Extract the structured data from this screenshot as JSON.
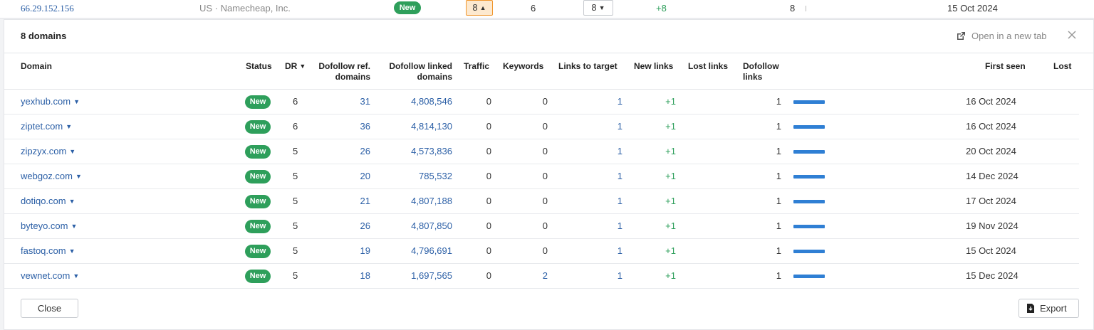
{
  "background_row": {
    "ip": "66.29.152.156",
    "location": "US · Namecheap, Inc.",
    "status": "New",
    "active_count": "8",
    "dofollow_count": "6",
    "dropdown_count": "8",
    "new_links": "+8",
    "links_count": "8",
    "first_seen": "15 Oct 2024"
  },
  "panel": {
    "title": "8 domains",
    "open_new_tab": "Open in a new tab"
  },
  "columns": {
    "domain": "Domain",
    "status": "Status",
    "dr": "DR",
    "dofollow_ref_domains": "Dofollow ref. domains",
    "dofollow_linked_domains": "Dofollow linked domains",
    "traffic": "Traffic",
    "keywords": "Keywords",
    "links_to_target": "Links to target",
    "new_links": "New links",
    "lost_links": "Lost links",
    "dofollow_links": "Dofollow links",
    "first_seen": "First seen",
    "lost": "Lost"
  },
  "rows": [
    {
      "domain": "yexhub.com",
      "status": "New",
      "dr": "6",
      "ref": "31",
      "linked": "4,808,546",
      "traffic": "0",
      "keywords": "0",
      "links_to_target": "1",
      "new_links": "+1",
      "dofollow": "1",
      "bar_level": 1,
      "first_seen": "16 Oct 2024"
    },
    {
      "domain": "ziptet.com",
      "status": "New",
      "dr": "6",
      "ref": "36",
      "linked": "4,814,130",
      "traffic": "0",
      "keywords": "0",
      "links_to_target": "1",
      "new_links": "+1",
      "dofollow": "1",
      "bar_level": 1,
      "first_seen": "16 Oct 2024"
    },
    {
      "domain": "zipzyx.com",
      "status": "New",
      "dr": "5",
      "ref": "26",
      "linked": "4,573,836",
      "traffic": "0",
      "keywords": "0",
      "links_to_target": "1",
      "new_links": "+1",
      "dofollow": "1",
      "bar_level": 1,
      "first_seen": "20 Oct 2024"
    },
    {
      "domain": "webgoz.com",
      "status": "New",
      "dr": "5",
      "ref": "20",
      "linked": "785,532",
      "traffic": "0",
      "keywords": "0",
      "links_to_target": "1",
      "new_links": "+1",
      "dofollow": "1",
      "bar_level": 1,
      "first_seen": "14 Dec 2024"
    },
    {
      "domain": "dotiqo.com",
      "status": "New",
      "dr": "5",
      "ref": "21",
      "linked": "4,807,188",
      "traffic": "0",
      "keywords": "0",
      "links_to_target": "1",
      "new_links": "+1",
      "dofollow": "1",
      "bar_level": 1,
      "first_seen": "17 Oct 2024"
    },
    {
      "domain": "byteyo.com",
      "status": "New",
      "dr": "5",
      "ref": "26",
      "linked": "4,807,850",
      "traffic": "0",
      "keywords": "0",
      "links_to_target": "1",
      "new_links": "+1",
      "dofollow": "1",
      "bar_level": 1,
      "first_seen": "19 Nov 2024"
    },
    {
      "domain": "fastoq.com",
      "status": "New",
      "dr": "5",
      "ref": "19",
      "linked": "4,796,691",
      "traffic": "0",
      "keywords": "0",
      "links_to_target": "1",
      "new_links": "+1",
      "dofollow": "1",
      "bar_level": 1,
      "first_seen": "15 Oct 2024"
    },
    {
      "domain": "vewnet.com",
      "status": "New",
      "dr": "5",
      "ref": "18",
      "linked": "1,697,565",
      "traffic": "0",
      "keywords": "2",
      "links_to_target": "1",
      "new_links": "+1",
      "dofollow": "1",
      "bar_level": 1,
      "first_seen": "15 Dec 2024"
    }
  ],
  "footer": {
    "close_label": "Close",
    "export_label": "Export"
  },
  "icons": {
    "open_new_tab": "external-link-icon",
    "close": "close-icon",
    "export": "export-icon",
    "sort": "sort-down-icon",
    "caret": "caret-down-icon"
  },
  "colors": {
    "link": "#2b5fa6",
    "new_badge": "#2e9f5b",
    "bar": "#2f7fd4",
    "active_outline": "#f0962d"
  }
}
